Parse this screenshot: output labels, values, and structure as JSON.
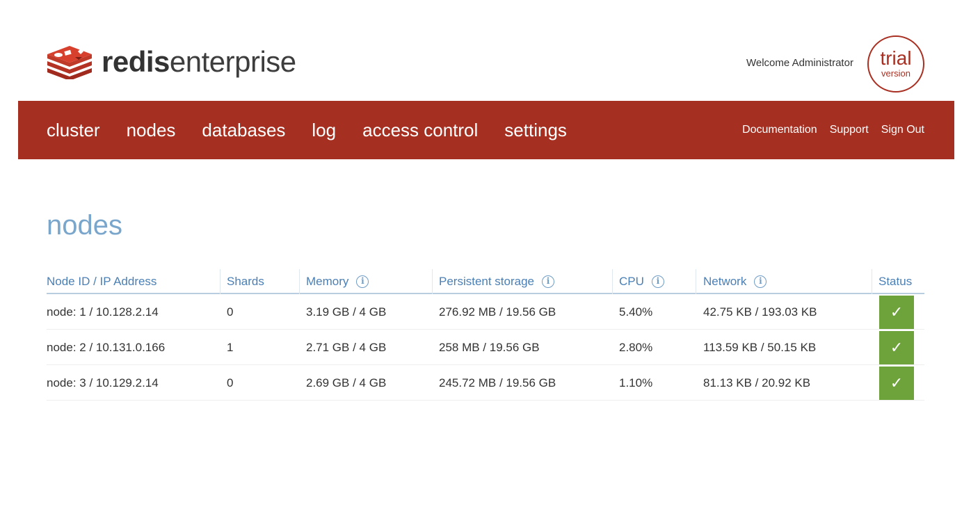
{
  "brand": {
    "bold": "redis",
    "light": "enterprise",
    "color": "#a52f20"
  },
  "header": {
    "welcome": "Welcome Administrator",
    "trial_line1": "trial",
    "trial_line2": "version"
  },
  "nav": {
    "items": [
      "cluster",
      "nodes",
      "databases",
      "log",
      "access control",
      "settings"
    ],
    "links": [
      "Documentation",
      "Support",
      "Sign Out"
    ]
  },
  "page": {
    "title": "nodes"
  },
  "table": {
    "columns": [
      {
        "label": "Node ID / IP Address",
        "info": false
      },
      {
        "label": "Shards",
        "info": false
      },
      {
        "label": "Memory",
        "info": true
      },
      {
        "label": "Persistent storage",
        "info": true
      },
      {
        "label": "CPU",
        "info": true
      },
      {
        "label": "Network",
        "info": true
      },
      {
        "label": "Status",
        "info": false
      }
    ],
    "rows": [
      {
        "node": "node: 1 / 10.128.2.14",
        "shards": "0",
        "memory": "3.19 GB / 4 GB",
        "storage": "276.92 MB / 19.56 GB",
        "cpu": "5.40%",
        "network": "42.75 KB / 193.03 KB",
        "status": "ok"
      },
      {
        "node": "node: 2 / 10.131.0.166",
        "shards": "1",
        "memory": "2.71 GB / 4 GB",
        "storage": "258 MB / 19.56 GB",
        "cpu": "2.80%",
        "network": "113.59 KB / 50.15 KB",
        "status": "ok"
      },
      {
        "node": "node: 3 / 10.129.2.14",
        "shards": "0",
        "memory": "2.69 GB / 4 GB",
        "storage": "245.72 MB / 19.56 GB",
        "cpu": "1.10%",
        "network": "81.13 KB / 20.92 KB",
        "status": "ok"
      }
    ],
    "status_glyph": "✓",
    "info_glyph": "i"
  },
  "colors": {
    "accent": "#a52f20",
    "heading": "#7aa6cc",
    "column_header": "#4a7fb5",
    "status_ok": "#6ea33c"
  }
}
